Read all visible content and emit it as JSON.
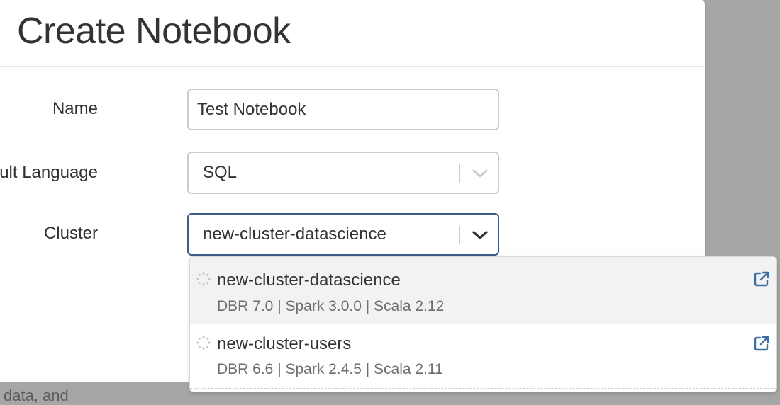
{
  "background": {
    "partial_text": "l data, and"
  },
  "dialog": {
    "title": "Create Notebook"
  },
  "form": {
    "name_label": "Name",
    "name_value": "Test Notebook",
    "language_label": "Default Language",
    "language_value": "SQL",
    "cluster_label": "Cluster",
    "cluster_value": "new-cluster-datascience"
  },
  "cluster_dropdown": {
    "options": [
      {
        "name": "new-cluster-datascience",
        "details": "DBR 7.0 | Spark 3.0.0 | Scala 2.12",
        "status_icon": "loading-spinner-icon",
        "link_icon": "external-link-icon",
        "highlighted": true
      },
      {
        "name": "new-cluster-users",
        "details": "DBR 6.6 | Spark 2.4.5 | Scala 2.11",
        "status_icon": "loading-spinner-icon",
        "link_icon": "external-link-icon",
        "highlighted": false
      }
    ]
  },
  "colors": {
    "focus_border": "#3a5c85",
    "link_icon": "#3a6ea5",
    "text": "#333333",
    "muted_text": "#6f6f6f",
    "overlay": "#a6a6a6"
  }
}
